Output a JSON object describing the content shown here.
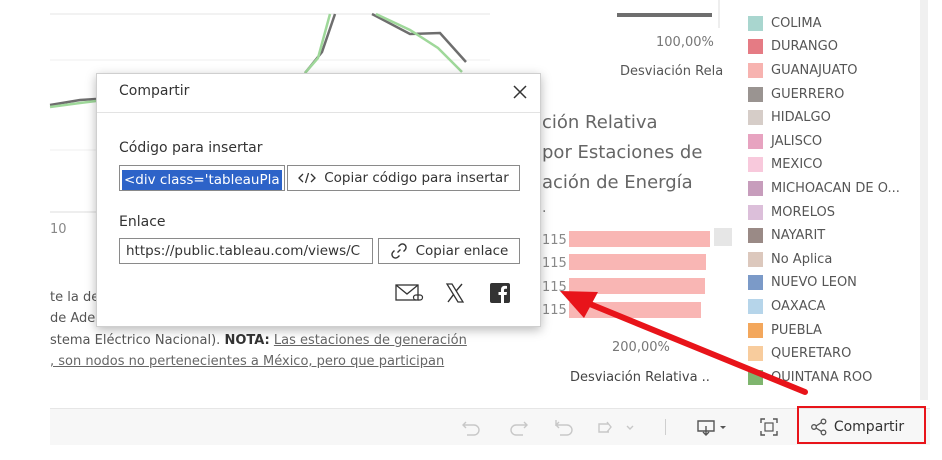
{
  "dashboard": {
    "center_heading_lines": [
      "ción Relativa",
      "por Estaciones de",
      "ación de Energía"
    ],
    "top_percent": "100,00%",
    "top_axis_title": "Desviación Rela",
    "bottom_percent": "200,00%",
    "bottom_axis_title": "Desviación Relativa ..",
    "bar_labels": [
      "115",
      "115",
      "115",
      "115"
    ],
    "left_tick": "10",
    "note_lines": [
      "te la de",
      "de Ade"
    ],
    "note_line3_plain": "stema Eléctrico Nacional). ",
    "note_line3_bold": "NOTA:",
    "note_line3_link": "Las estaciones de generación",
    "note_line4_link": ", son nodos no pertenecientes a México, pero que participan",
    "colors": {
      "bar": "#f9b6b4",
      "line_dark": "#6e6e6e",
      "line_green": "#9fd89a",
      "highlight": "#e8141a",
      "selection": "#2d63c8"
    }
  },
  "legend": {
    "items": [
      {
        "label": "COLIMA",
        "color": "#a9d6cf"
      },
      {
        "label": "DURANGO",
        "color": "#e57b84"
      },
      {
        "label": "GUANAJUATO",
        "color": "#f7b3b0"
      },
      {
        "label": "GUERRERO",
        "color": "#9a9491"
      },
      {
        "label": "HIDALGO",
        "color": "#d6cdc8"
      },
      {
        "label": "JALISCO",
        "color": "#e7a3c0"
      },
      {
        "label": "MEXICO",
        "color": "#f8c9dc"
      },
      {
        "label": "MICHOACAN DE O...",
        "color": "#c79dbc"
      },
      {
        "label": "MORELOS",
        "color": "#dcbfda"
      },
      {
        "label": "NAYARIT",
        "color": "#9a8a86"
      },
      {
        "label": "No Aplica",
        "color": "#dcc8bd"
      },
      {
        "label": "NUEVO LEON",
        "color": "#7b9ac8"
      },
      {
        "label": "OAXACA",
        "color": "#b6d5ea"
      },
      {
        "label": "PUEBLA",
        "color": "#f3a75c"
      },
      {
        "label": "QUERETARO",
        "color": "#f8cc9d"
      },
      {
        "label": "QUINTANA ROO",
        "color": "#7fb56e"
      }
    ]
  },
  "toolbar": {
    "share_label": "Compartir"
  },
  "share_dialog": {
    "title": "Compartir",
    "embed_label": "Código para insertar",
    "embed_value": "<div class='tableauPla",
    "copy_embed_label": "Copiar código para insertar",
    "link_label": "Enlace",
    "link_value": "https://public.tableau.com/views/C",
    "copy_link_label": "Copiar enlace"
  }
}
